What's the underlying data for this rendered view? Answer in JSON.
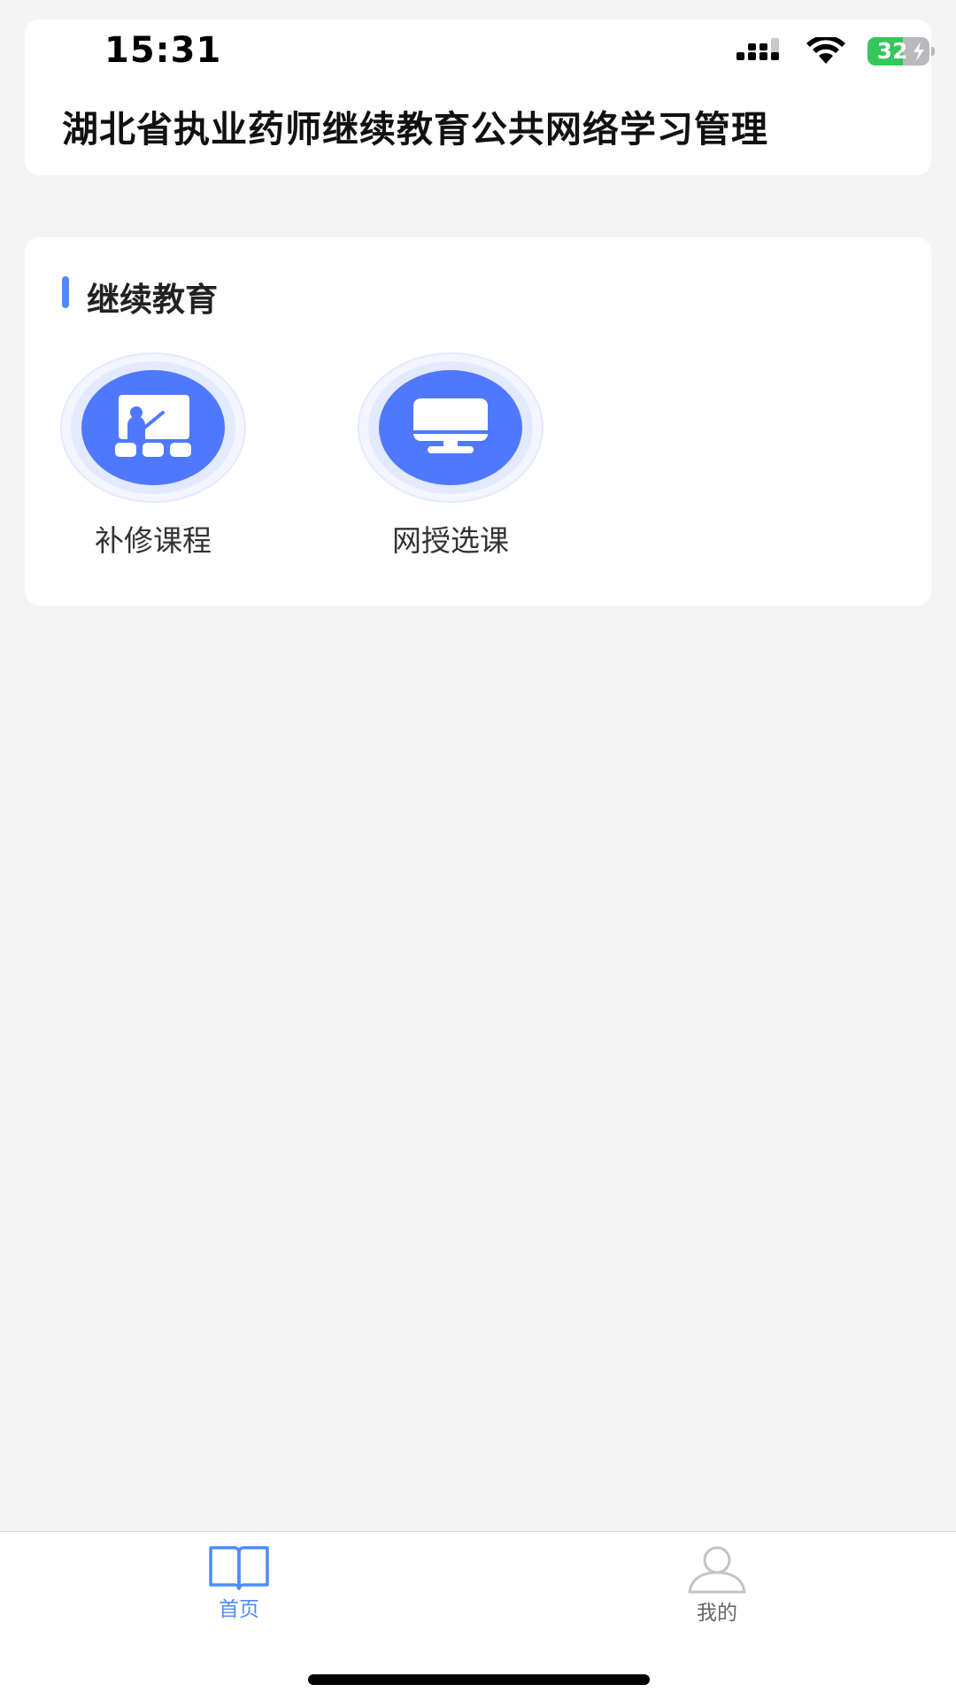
{
  "status_bar": {
    "time": "15:31",
    "battery_level": "32",
    "battery_percent": 32,
    "battery_color": "#34c759",
    "icons": [
      "signal-icon",
      "wifi-icon",
      "battery-icon",
      "charging-bolt-icon"
    ]
  },
  "header": {
    "title": "湖北省执业药师继续教育公共网络学习管理"
  },
  "section": {
    "title": "继续教育",
    "accent_color": "#4f8bff",
    "entries": [
      {
        "label": "补修课程",
        "icon": "classroom-teacher-icon",
        "color": "#5078ff"
      },
      {
        "label": "网授选课",
        "icon": "computer-monitor-icon",
        "color": "#5078ff"
      }
    ]
  },
  "tab_bar": {
    "items": [
      {
        "label": "首页",
        "icon": "book-icon",
        "active": true,
        "color": "#4f8bff"
      },
      {
        "label": "我的",
        "icon": "user-icon",
        "active": false,
        "color": "#666666"
      }
    ]
  }
}
